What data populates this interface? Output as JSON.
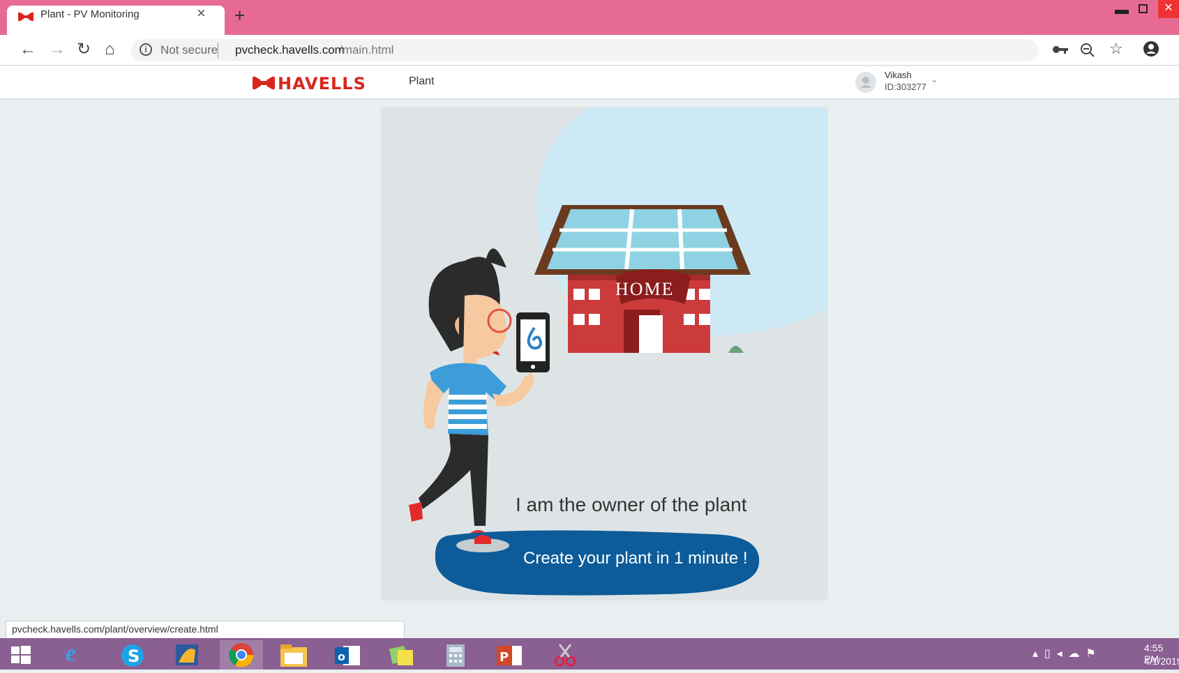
{
  "browser": {
    "tab_title": "Plant - PV Monitoring",
    "tab_close": "×",
    "new_tab": "+",
    "not_secure": "Not secure",
    "url_host": "pvcheck.havells.com",
    "url_path": "/main.html",
    "status_url": "pvcheck.havells.com/plant/overview/create.html",
    "window_controls": [
      "minimize",
      "maximize",
      "close"
    ]
  },
  "header": {
    "logo_text": "HAVELLS",
    "nav": [
      "Plant"
    ],
    "user": {
      "name": "Vikash",
      "id": "ID:303277"
    }
  },
  "card": {
    "house_sign": "HOME",
    "owner_text": "I am the owner of the plant",
    "create_label": "Create your plant in 1 minute !"
  },
  "taskbar": {
    "apps": [
      "windows-start",
      "internet-explorer",
      "skype",
      "file-manager",
      "chrome",
      "file-explorer",
      "outlook",
      "sticky-notes",
      "calculator",
      "powerpoint",
      "snipping-tool"
    ],
    "time": "4:55 PM",
    "date": "4/1/2019"
  },
  "colors": {
    "tabstrip": "#e66a91",
    "brand_red": "#d9261c",
    "cta_blue": "#0d5c99",
    "taskbar": "#8a5f92"
  }
}
